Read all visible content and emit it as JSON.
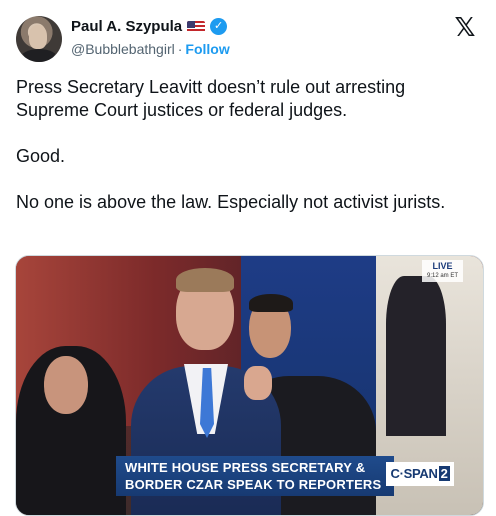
{
  "author": {
    "display_name": "Paul A. Szypula",
    "handle": "@Bubblebathgirl",
    "separator": "·",
    "follow_label": "Follow",
    "verified_symbol": "✓",
    "flag_icon": "us-flag-icon",
    "avatar_icon": "avatar"
  },
  "platform": {
    "logo_text": "𝕏",
    "logo_icon": "x-logo-icon"
  },
  "tweet": {
    "paragraphs": [
      "Press Secretary Leavitt doesn’t rule out arresting Supreme Court justices or federal judges.",
      "Good.",
      "No one is above the law. Especially not activist jurists."
    ]
  },
  "media": {
    "live_label": "LIVE",
    "live_time": "9:12 am ET",
    "chyron_line1": "WHITE HOUSE PRESS SECRETARY &",
    "chyron_line2": "BORDER CZAR SPEAK TO REPORTERS",
    "network_text": "C·SPAN",
    "network_number": "2"
  },
  "colors": {
    "accent": "#1d9bf0",
    "text": "#0f1419",
    "muted": "#536471",
    "chyron": "#173a72"
  }
}
